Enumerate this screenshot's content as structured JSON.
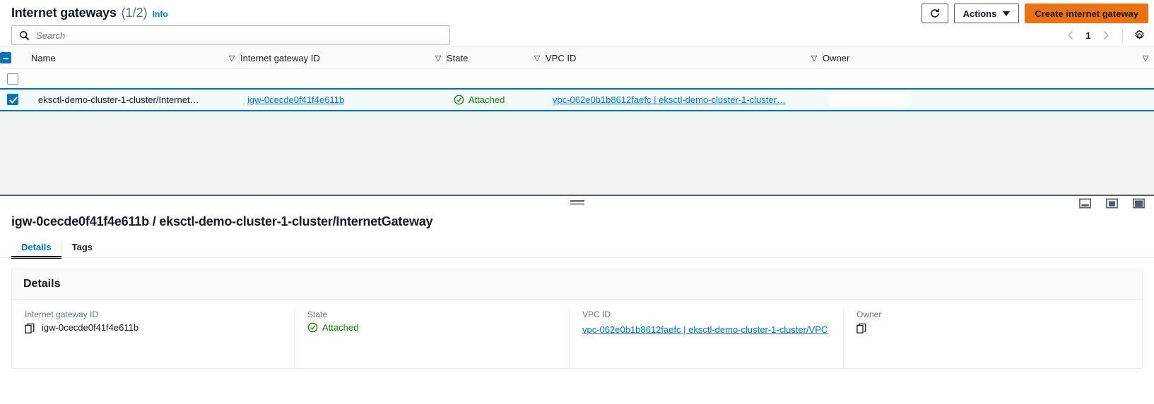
{
  "header": {
    "title": "Internet gateways",
    "count": "(1/2)",
    "info_label": "Info",
    "refresh_icon": "refresh-icon",
    "actions_label": "Actions",
    "create_label": "Create internet gateway"
  },
  "search": {
    "placeholder": "Search",
    "value": "",
    "icon": "search-icon"
  },
  "pagination": {
    "prev_icon": "chevron-left-icon",
    "page": "1",
    "next_icon": "chevron-right-icon",
    "settings_icon": "gear-icon"
  },
  "table": {
    "columns": [
      {
        "label": "Name",
        "sort_icon": "sort-icon"
      },
      {
        "label": "Internet gateway ID",
        "sort_icon": "sort-icon"
      },
      {
        "label": "State",
        "sort_icon": "sort-icon"
      },
      {
        "label": "VPC ID",
        "sort_icon": "sort-icon"
      },
      {
        "label": "Owner",
        "sort_icon": "sort-icon"
      }
    ],
    "rows": [
      {
        "selected": true,
        "name": "eksctl-demo-cluster-1-cluster/Internet…",
        "gateway_id": "igw-0cecde0f41f4e611b",
        "state": "Attached",
        "state_icon": "check-circle-icon",
        "vpc_id": "vpc-062e0b1b8612faefc | eksctl-demo-cluster-1-cluster…",
        "owner": ""
      }
    ]
  },
  "split_panel": {
    "drag_handle": "resize-handle",
    "layout_icons": [
      "panel-bottom-icon",
      "panel-side-icon",
      "panel-full-icon"
    ],
    "title": "igw-0cecde0f41f4e611b / eksctl-demo-cluster-1-cluster/InternetGateway",
    "tabs": [
      {
        "label": "Details",
        "active": true
      },
      {
        "label": "Tags",
        "active": false
      }
    ],
    "details_card": {
      "heading": "Details",
      "fields": [
        {
          "label": "Internet gateway ID",
          "value": "igw-0cecde0f41f4e611b",
          "copy_icon": "copy-icon",
          "is_link": false
        },
        {
          "label": "State",
          "value": "Attached",
          "status_icon": "check-circle-icon",
          "is_link": false
        },
        {
          "label": "VPC ID",
          "value": "vpc-062e0b1b8612faefc | eksctl-demo-cluster-1-cluster/VPC",
          "is_link": true
        },
        {
          "label": "Owner",
          "value": "",
          "copy_icon": "copy-icon",
          "is_link": false
        }
      ]
    }
  },
  "colors": {
    "accent_blue": "#0073bb",
    "brand_orange": "#ec7211",
    "status_green": "#1d8102",
    "selected_row_bg": "#f1faff",
    "panel_border": "#545b64"
  }
}
